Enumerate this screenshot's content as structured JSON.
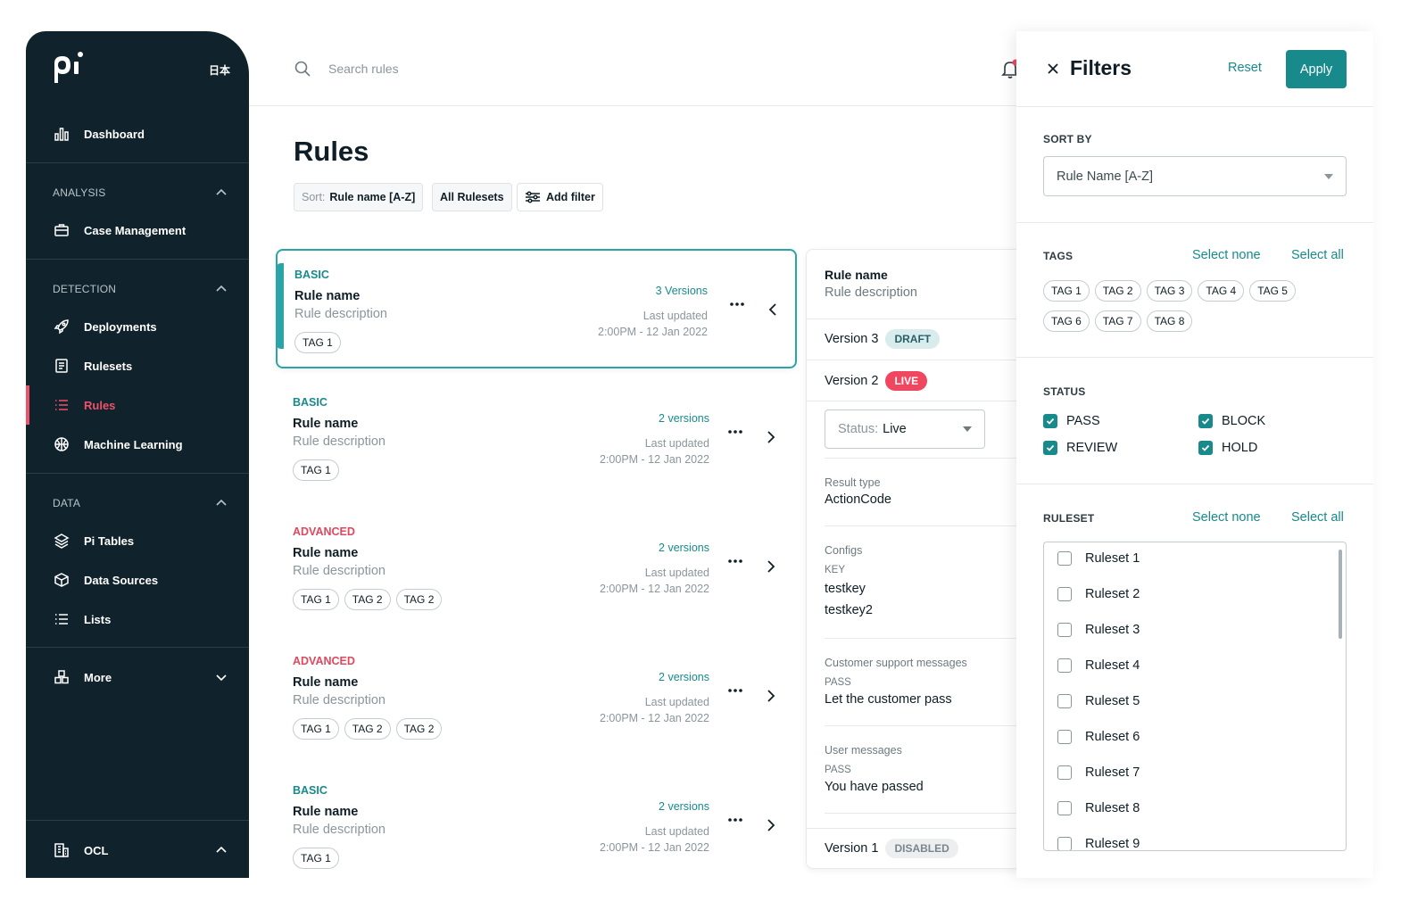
{
  "sidebar": {
    "lang": "日本",
    "dashboard": "Dashboard",
    "sections": {
      "analysis": "ANALYSIS",
      "detection": "DETECTION",
      "data": "DATA"
    },
    "items": {
      "case_management": "Case Management",
      "deployments": "Deployments",
      "rulesets": "Rulesets",
      "rules": "Rules",
      "machine_learning": "Machine Learning",
      "pi_tables": "Pi Tables",
      "data_sources": "Data Sources",
      "lists": "Lists",
      "more": "More",
      "org": "OCL"
    },
    "active": "rules",
    "accent": "#f0516a"
  },
  "topbar": {
    "search_placeholder": "Search rules",
    "notification_dot": true
  },
  "page": {
    "title": "Rules",
    "sort_prefix": "Sort:",
    "sort_value": "Rule name [A-Z]",
    "rulesets_chip": "All Rulesets",
    "add_filter": "Add filter"
  },
  "rules": [
    {
      "type": "BASIC",
      "kind": "basic",
      "name": "Rule name",
      "desc": "Rule description",
      "versions": "3 Versions",
      "updated_label": "Last updated",
      "updated": "2:00PM - 12 Jan 2022",
      "tags": [
        "TAG 1"
      ],
      "selected": true
    },
    {
      "type": "BASIC",
      "kind": "basic",
      "name": "Rule name",
      "desc": "Rule description",
      "versions": "2 versions",
      "updated_label": "Last updated",
      "updated": "2:00PM - 12 Jan 2022",
      "tags": [
        "TAG 1"
      ],
      "selected": false
    },
    {
      "type": "ADVANCED",
      "kind": "advanced",
      "name": "Rule name",
      "desc": "Rule description",
      "versions": "2 versions",
      "updated_label": "Last updated",
      "updated": "2:00PM - 12 Jan 2022",
      "tags": [
        "TAG 1",
        "TAG 2",
        "TAG 2"
      ],
      "selected": false
    },
    {
      "type": "ADVANCED",
      "kind": "advanced",
      "name": "Rule name",
      "desc": "Rule description",
      "versions": "2 versions",
      "updated_label": "Last updated",
      "updated": "2:00PM - 12 Jan 2022",
      "tags": [
        "TAG 1",
        "TAG 2",
        "TAG 2"
      ],
      "selected": false
    },
    {
      "type": "BASIC",
      "kind": "basic",
      "name": "Rule name",
      "desc": "Rule description",
      "versions": "2 versions",
      "updated_label": "Last updated",
      "updated": "2:00PM - 12 Jan 2022",
      "tags": [
        "TAG 1"
      ],
      "selected": false
    }
  ],
  "detail": {
    "name": "Rule name",
    "desc": "Rule description",
    "v3_label": "Version 3",
    "v3_badge": "DRAFT",
    "v2_label": "Version 2",
    "v2_badge": "LIVE",
    "status_prefix": "Status:",
    "status_value": "Live",
    "result_type_label": "Result type",
    "result_type_value": "ActionCode",
    "configs_label": "Configs",
    "key_label": "KEY",
    "key1": "testkey",
    "key2": "testkey2",
    "csm_label": "Customer support messages",
    "csm_code": "PASS",
    "csm_text": "Let the customer pass",
    "um_label": "User messages",
    "um_code": "PASS",
    "um_text": "You have passed",
    "v1_label": "Version 1",
    "v1_badge": "DISABLED"
  },
  "filters": {
    "title": "Filters",
    "reset": "Reset",
    "apply": "Apply",
    "sort_by_label": "SORT BY",
    "sort_by_value": "Rule Name [A-Z]",
    "tags_label": "TAGS",
    "select_none": "Select none",
    "select_all": "Select all",
    "tags": [
      "TAG 1",
      "TAG 2",
      "TAG 3",
      "TAG 4",
      "TAG 5",
      "TAG 6",
      "TAG 7",
      "TAG 8"
    ],
    "status_label": "STATUS",
    "statuses": [
      {
        "label": "PASS",
        "checked": true
      },
      {
        "label": "BLOCK",
        "checked": true
      },
      {
        "label": "REVIEW",
        "checked": true
      },
      {
        "label": "HOLD",
        "checked": true
      }
    ],
    "ruleset_label": "RULESET",
    "rulesets": [
      "Ruleset 1",
      "Ruleset 2",
      "Ruleset 3",
      "Ruleset 4",
      "Ruleset 5",
      "Ruleset 6",
      "Ruleset 7",
      "Ruleset 8",
      "Ruleset 9"
    ],
    "accent": "#188a8c"
  }
}
